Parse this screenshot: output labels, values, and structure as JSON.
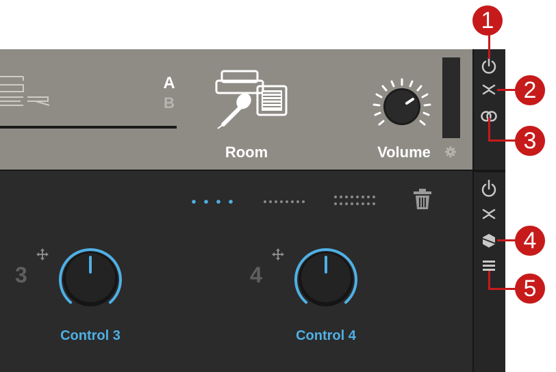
{
  "header": {
    "ab_a": "A",
    "ab_b": "B",
    "room_label": "Room",
    "volume_label": "Volume"
  },
  "controls": [
    {
      "number": "3",
      "label": "Control 3"
    },
    {
      "number": "4",
      "label": "Control 4"
    }
  ],
  "page_dots": [
    "4-dots",
    "8-dots",
    "16-dots"
  ],
  "callouts": [
    "1",
    "2",
    "3",
    "4",
    "5"
  ],
  "icons": {
    "top_sidebar": [
      "power-icon",
      "collapse-icon",
      "link-icon"
    ],
    "bottom_sidebar": [
      "power-icon",
      "collapse-icon",
      "hex-icon",
      "menu-icon"
    ],
    "other": [
      "trash-icon",
      "gear-icon",
      "move-icon",
      "room-icon"
    ]
  },
  "colors": {
    "accent_blue": "#4fb0e6",
    "callout_red": "#c71a1a",
    "top_panel": "#8f8c86",
    "bottom_panel": "#2b2b2b"
  }
}
